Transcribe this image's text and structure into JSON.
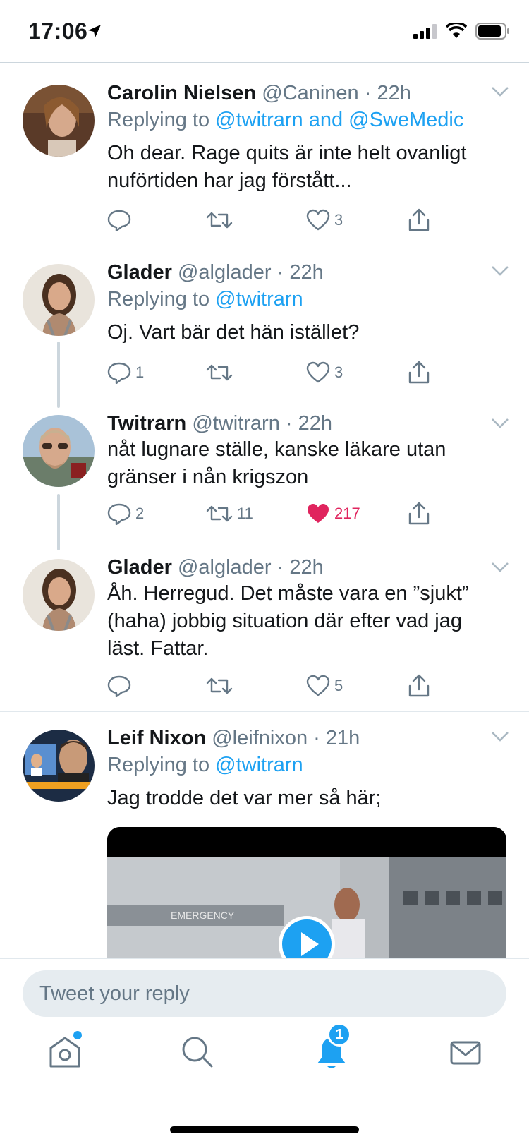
{
  "status_bar": {
    "time": "17:06"
  },
  "tweets": [
    {
      "name": "Carolin Nielsen",
      "handle": "@Caninen",
      "time": "22h",
      "replying_prefix": "Replying to ",
      "replying_mentions": "@twitrarn and @SweMedic",
      "text": "Oh dear. Rage quits är inte helt ovanligt nuförtiden har jag förstått...",
      "replies": "",
      "retweets": "",
      "likes": "3"
    },
    {
      "name": "Glader",
      "handle": "@algladerʼ",
      "time": "22h",
      "replying_prefix": "Replying to ",
      "replying_mentions": "@twitrarn",
      "text": "Oj. Vart bär det hän istället?",
      "replies": "1",
      "retweets": "",
      "likes": "3"
    },
    {
      "name": "Twitrarn",
      "handle": "@twitrarn",
      "time": "22h",
      "text": "nåt lugnare ställe, kanske läkare utan gränser i nån krigszon",
      "replies": "2",
      "retweets": "11",
      "likes": "217"
    },
    {
      "name": "Glader",
      "handle": "@alglader",
      "time": "22h",
      "text": "Åh. Herregud. Det måste vara en ”sjukt” (haha) jobbig situation där efter vad jag läst. Fattar.",
      "replies": "",
      "retweets": "",
      "likes": "5"
    },
    {
      "name": "Leif Nixon",
      "handle": "@leifnixon",
      "time": "21h",
      "replying_prefix": "Replying to ",
      "replying_mentions": "@twitrarn",
      "text": "Jag trodde det var mer så här;"
    }
  ],
  "media": {
    "sign_text": "EMERGENCY"
  },
  "composer": {
    "placeholder": "Tweet your reply"
  },
  "tabbar": {
    "notification_count": "1"
  },
  "colors": {
    "accent": "#1da1f2",
    "like": "#e0245e",
    "muted": "#657786"
  }
}
